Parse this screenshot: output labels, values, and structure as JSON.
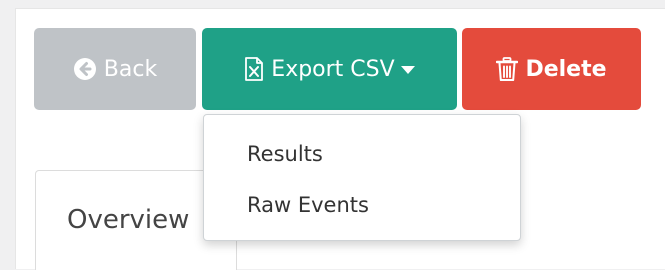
{
  "toolbar": {
    "back_label": "Back",
    "back_icon": "circle-arrow-left-icon",
    "export_label": "Export CSV",
    "export_icon": "file-excel-icon",
    "delete_label": "Delete",
    "delete_icon": "trash-icon",
    "colors": {
      "back": "#bfc3c7",
      "export": "#1fa187",
      "delete": "#e44b3c"
    }
  },
  "export_menu": {
    "items": [
      {
        "label": "Results"
      },
      {
        "label": "Raw Events"
      }
    ]
  },
  "tabs": {
    "overview_label": "Overview"
  }
}
